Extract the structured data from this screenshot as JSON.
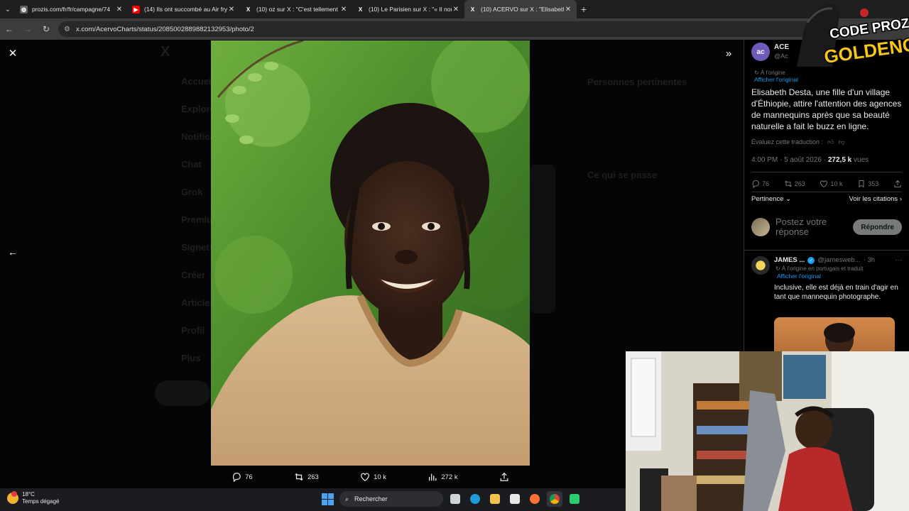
{
  "browser": {
    "tabs": [
      {
        "title": "prozis.com/fr/fr/campagne/74",
        "favicon": "prozis-icon",
        "favicon_color": "#5f6368",
        "active": false
      },
      {
        "title": "(14) Ils ont succombé au Air fry",
        "favicon": "youtube-icon",
        "favicon_color": "#ff0000",
        "active": false
      },
      {
        "title": "(10) oz sur X : \"C'est tellement l",
        "favicon": "x-icon",
        "favicon_color": "#000000",
        "active": false
      },
      {
        "title": "(10) Le Parisien sur X : \"« Il nou",
        "favicon": "x-icon",
        "favicon_color": "#000000",
        "active": false
      },
      {
        "title": "(10) ACERVO sur X : \"Elisabeth",
        "favicon": "x-icon",
        "favicon_color": "#000000",
        "active": true
      }
    ],
    "url": "x.com/AcervoCharts/status/2085002889882132953/photo/2"
  },
  "viewer": {
    "stats": {
      "replies": "76",
      "reposts": "263",
      "likes": "10 k",
      "views": "272 k"
    },
    "ghost_nav": [
      "Accueil",
      "Explorer",
      "Notifications",
      "Chat",
      "Grok",
      "Premium",
      "Signets",
      "Créer",
      "Articles",
      "Profil",
      "Plus"
    ],
    "ghost_right": {
      "heading1": "Personnes pertinentes",
      "heading2": "Ce qui se passe"
    }
  },
  "tweet": {
    "author_name": "ACE",
    "author_handle": "@Ac",
    "avatar_text": "ac",
    "translated_note": "À l'origine",
    "show_original": "Afficher l'original",
    "text": "Elisabeth Desta, une fille d'un village d'Éthiopie, attire l'attention des agences de mannequins après que sa beauté naturelle a fait le buzz en ligne.",
    "rate_translation": "Évaluez cette traduction :",
    "time": "4:00 PM · 5 août 2026 ·",
    "views": "272,5 k",
    "views_label": "vues",
    "replies": "76",
    "reposts": "263",
    "likes": "10 k",
    "bookmarks": "353",
    "sort_label": "Pertinence",
    "quotes_link": "Voir les citations",
    "reply_placeholder": "Postez votre réponse",
    "reply_button": "Répondre"
  },
  "reply": {
    "name": "JAMES ...",
    "handle": "@jamesweb...",
    "age": "· 3h",
    "translated_note": "À l'origine en portugais et traduit",
    "show_original": "Afficher l'original",
    "text": "Inclusive, elle est déjà en train d'agir en tant que mannequin photographe."
  },
  "overlay": {
    "line1": "CODE PROZIS",
    "line2": "GOLDENG"
  },
  "taskbar": {
    "temperature": "18°C",
    "weather": "Temps dégagé",
    "search_placeholder": "Rechercher"
  }
}
